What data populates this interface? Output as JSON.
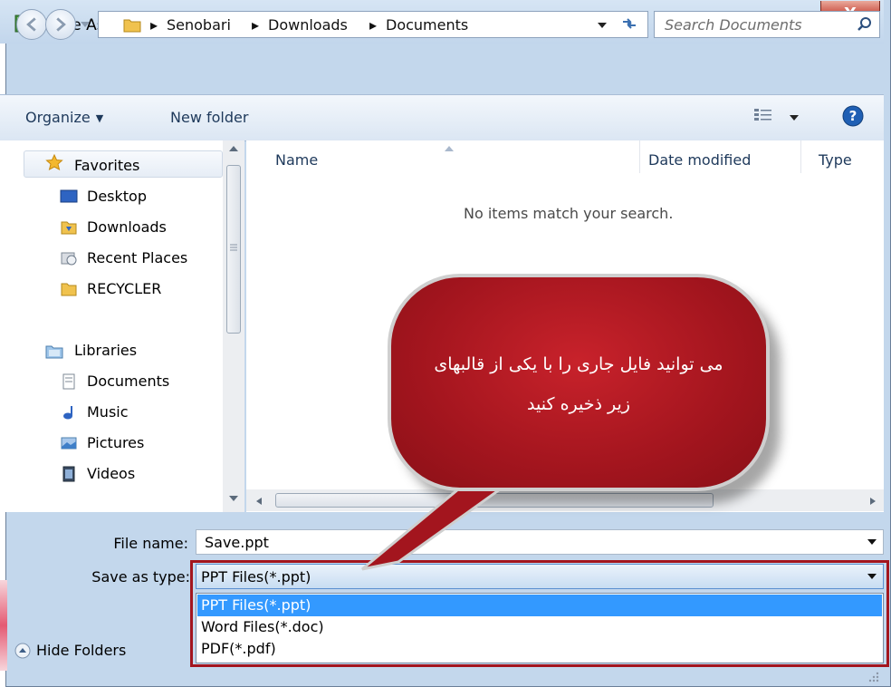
{
  "window": {
    "title": "Save As",
    "close_label": "X"
  },
  "nav": {
    "breadcrumbs": [
      "Senobari",
      "Downloads",
      "Documents"
    ],
    "separator": "▸",
    "search_placeholder": "Search Documents"
  },
  "toolbar": {
    "organize_label": "Organize",
    "organize_caret": "▼",
    "new_folder_label": "New folder",
    "help_glyph": "?"
  },
  "sidebar": {
    "favorites_header": "Favorites",
    "favorites": [
      "Desktop",
      "Downloads",
      "Recent Places",
      "RECYCLER"
    ],
    "libraries_header": "Libraries",
    "libraries": [
      "Documents",
      "Music",
      "Pictures",
      "Videos"
    ]
  },
  "file_list": {
    "columns": [
      "Name",
      "Date modified",
      "Type"
    ],
    "empty_message": "No items match your search."
  },
  "callout": {
    "line1": "می توانید فایل جاری را با یکی از قالبهای",
    "line2": "زیر ذخیره کنید"
  },
  "form": {
    "file_name_label": "File name:",
    "file_name_value": "Save.ppt",
    "save_type_label": "Save as type:",
    "save_type_value": "PPT Files(*.ppt)",
    "save_type_options": [
      "PPT Files(*.ppt)",
      "Word Files(*.doc)",
      "PDF(*.pdf)"
    ]
  },
  "footer": {
    "hide_folders_label": "Hide Folders"
  },
  "colors": {
    "callout": "#a3151e",
    "selection": "#3399ff",
    "link_text": "#1e395b"
  }
}
